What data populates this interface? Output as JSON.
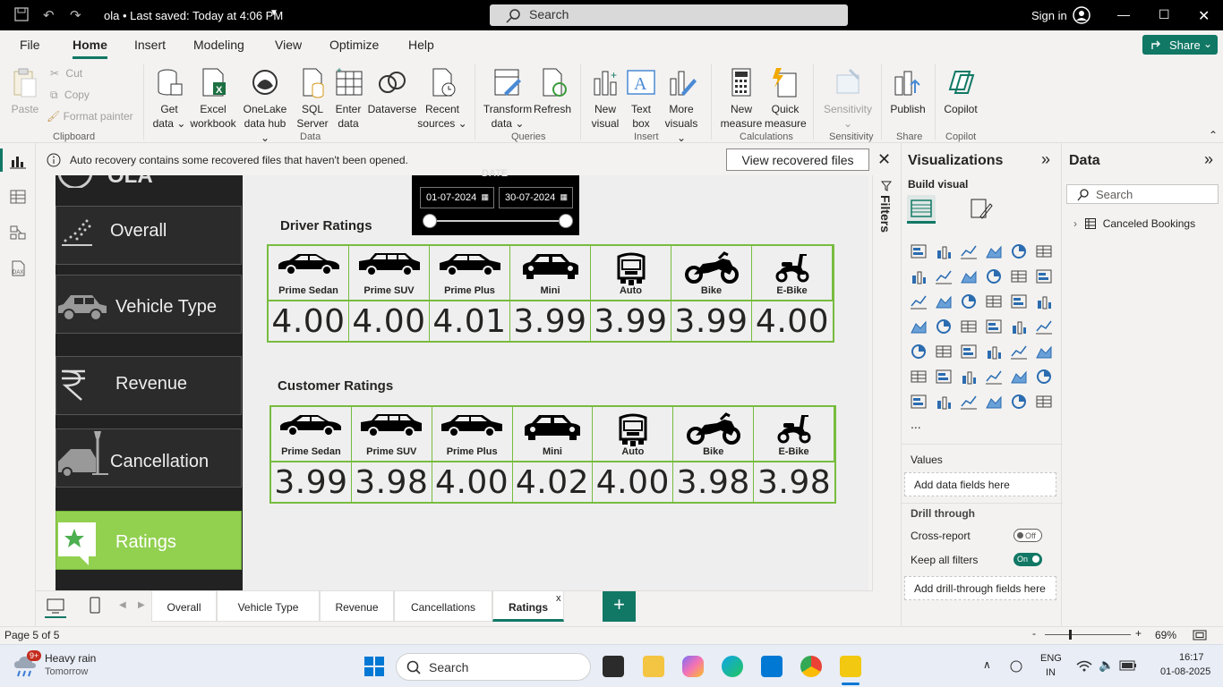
{
  "titlebar": {
    "title": "ola • Last saved: Today at 4:06 PM",
    "search_placeholder": "Search",
    "signin": "Sign in"
  },
  "menu": [
    "File",
    "Home",
    "Insert",
    "Modeling",
    "View",
    "Optimize",
    "Help"
  ],
  "share_label": "Share",
  "ribbon": {
    "clipboard": {
      "paste": "Paste",
      "cut": "Cut",
      "copy": "Copy",
      "format_painter": "Format painter",
      "group": "Clipboard"
    },
    "data": {
      "get_data": [
        "Get",
        "data"
      ],
      "excel": [
        "Excel",
        "workbook"
      ],
      "onelake": [
        "OneLake",
        "data hub"
      ],
      "sql": [
        "SQL",
        "Server"
      ],
      "enter": [
        "Enter",
        "data"
      ],
      "dataverse": "Dataverse",
      "recent": [
        "Recent",
        "sources"
      ],
      "group": "Data"
    },
    "queries": {
      "transform": [
        "Transform",
        "data"
      ],
      "refresh": "Refresh",
      "group": "Queries"
    },
    "insert": {
      "new_visual": [
        "New",
        "visual"
      ],
      "text_box": [
        "Text",
        "box"
      ],
      "more_visuals": [
        "More",
        "visuals"
      ],
      "group": "Insert"
    },
    "calculations": {
      "new_measure": [
        "New",
        "measure"
      ],
      "quick_measure": [
        "Quick",
        "measure"
      ],
      "group": "Calculations"
    },
    "sensitivity": {
      "label": "Sensitivity",
      "group": "Sensitivity"
    },
    "share": {
      "publish": "Publish",
      "group": "Share"
    },
    "copilot": {
      "label": "Copilot",
      "group": "Copilot"
    }
  },
  "notification": {
    "text": "Auto recovery contains some recovered files that haven't been opened.",
    "button": "View recovered files"
  },
  "canvas": {
    "nav": [
      "Overall",
      "Vehicle Type",
      "Revenue",
      "Cancellation",
      "Ratings"
    ],
    "date_slicer": {
      "label": "DATE",
      "start": "01-07-2024",
      "end": "30-07-2024"
    },
    "driver_title": "Driver Ratings",
    "customer_title": "Customer Ratings",
    "vehicles": [
      "Prime Sedan",
      "Prime SUV",
      "Prime Plus",
      "Mini",
      "Auto",
      "Bike",
      "E-Bike"
    ],
    "driver_ratings": [
      "4.00",
      "4.00",
      "4.01",
      "3.99",
      "3.99",
      "3.99",
      "4.00"
    ],
    "customer_ratings": [
      "3.99",
      "3.98",
      "4.00",
      "4.02",
      "4.00",
      "3.98",
      "3.98"
    ]
  },
  "filters_label": "Filters",
  "visualizations": {
    "title": "Visualizations",
    "build_visual": "Build visual",
    "values_label": "Values",
    "values_placeholder": "Add data fields here",
    "drill_through": "Drill through",
    "cross_report": "Cross-report",
    "cross_report_state": "Off",
    "keep_filters": "Keep all filters",
    "keep_filters_state": "On",
    "drill_placeholder": "Add drill-through fields here",
    "more": "..."
  },
  "data_pane": {
    "title": "Data",
    "search_placeholder": "Search",
    "table": "Canceled Bookings"
  },
  "page_tabs": [
    "Overall",
    "Vehicle Type",
    "Revenue",
    "Cancellations",
    "Ratings"
  ],
  "status": {
    "page": "Page 5 of 5",
    "zoom": "69%"
  },
  "taskbar": {
    "weather": "Heavy rain",
    "weather_sub": "Tomorrow",
    "weather_badge": "9+",
    "search": "Search",
    "lang": "ENG",
    "region": "IN",
    "time": "16:17",
    "date": "01-08-2025"
  }
}
